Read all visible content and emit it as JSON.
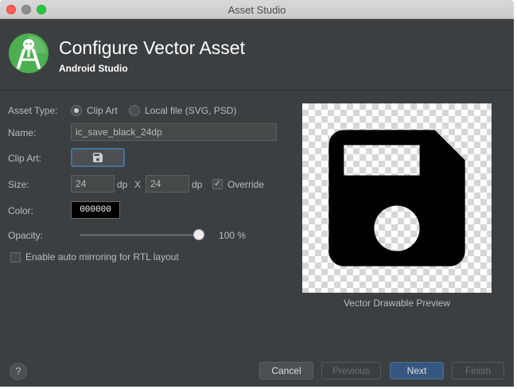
{
  "window": {
    "title": "Asset Studio"
  },
  "header": {
    "title": "Configure Vector Asset",
    "subtitle": "Android Studio",
    "logo_icon": "android-studio-logo"
  },
  "form": {
    "asset_type_label": "Asset Type:",
    "asset_type_options": [
      {
        "label": "Clip Art",
        "selected": true
      },
      {
        "label": "Local file (SVG, PSD)",
        "selected": false
      }
    ],
    "name_label": "Name:",
    "name_value": "ic_save_black_24dp",
    "clip_art_label": "Clip Art:",
    "clip_art_icon": "save-icon",
    "size_label": "Size:",
    "width_value": "24",
    "height_value": "24",
    "unit": "dp",
    "size_separator": "X",
    "override_label": "Override",
    "override_checked": true,
    "color_label": "Color:",
    "color_value": "000000",
    "opacity_label": "Opacity:",
    "opacity_value": "100 %",
    "opacity_level": 1.0,
    "rtl_label": "Enable auto mirroring for RTL layout",
    "rtl_checked": false
  },
  "preview": {
    "caption": "Vector Drawable Preview",
    "icon": "save-icon",
    "fill_color": "#000000"
  },
  "footer": {
    "help_label": "?",
    "cancel_label": "Cancel",
    "previous_label": "Previous",
    "next_label": "Next",
    "finish_label": "Finish"
  }
}
